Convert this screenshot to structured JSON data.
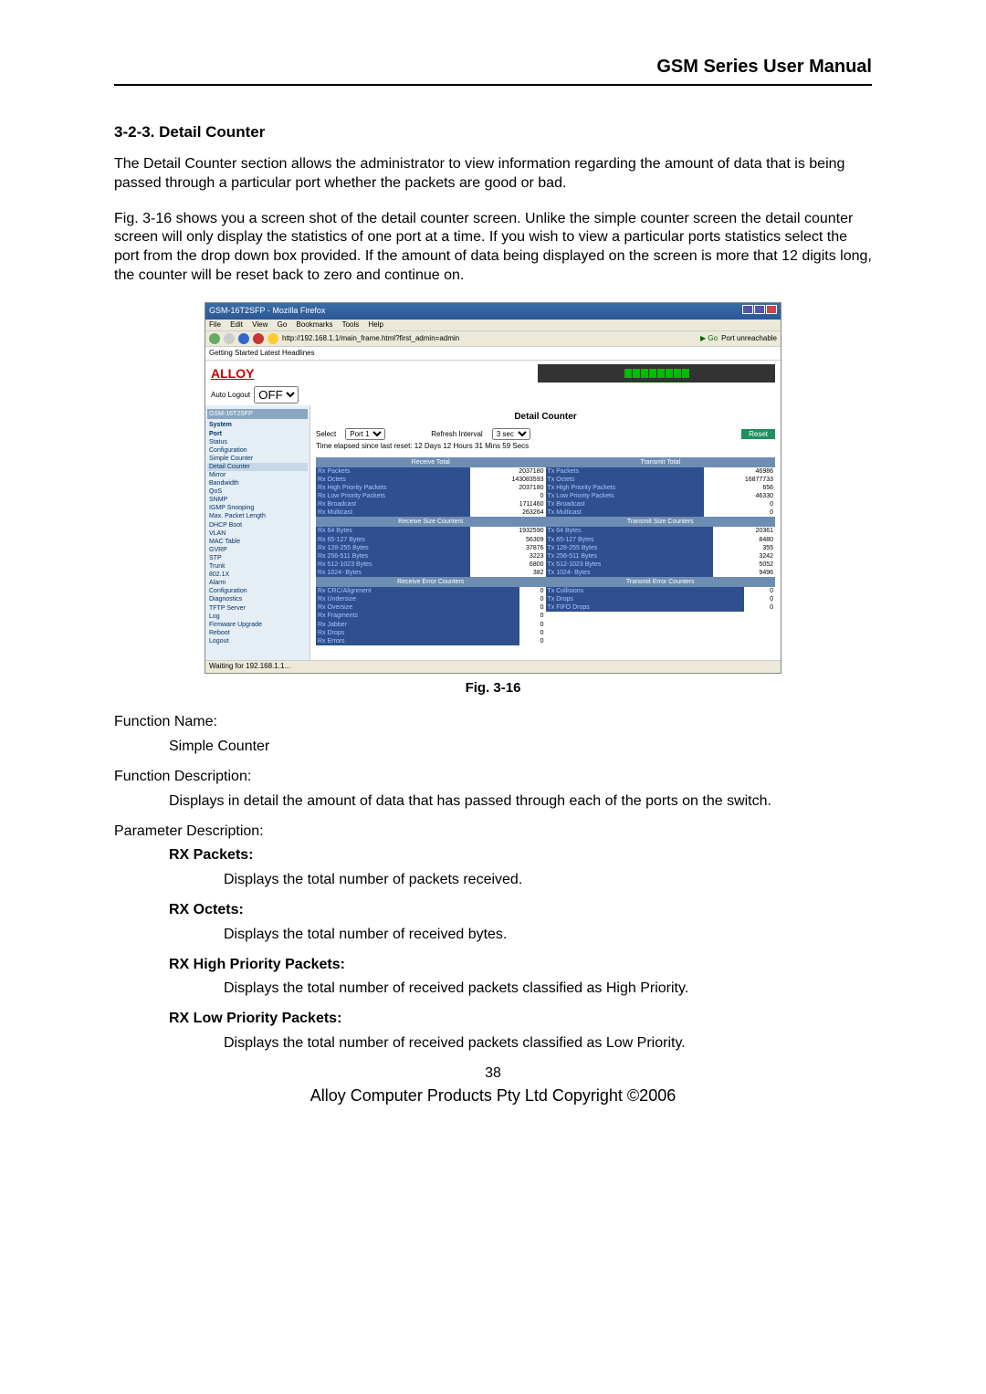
{
  "header_title": "GSM Series User Manual",
  "section_heading": "3-2-3. Detail Counter",
  "para1": "The Detail Counter section allows the administrator to view information regarding the amount of data that is being passed through a particular port whether the packets are good or bad.",
  "para2": "Fig. 3-16 shows you a screen shot of the detail counter screen. Unlike the simple counter screen the detail counter screen will only display the statistics of one port at a time. If you wish to view a particular ports statistics select the port from the drop down box provided. If the amount of data being displayed on the screen is more that 12 digits long, the counter will be reset back to zero and continue on.",
  "figure_caption": "Fig. 3-16",
  "function_name_label": "Function Name:",
  "function_name_value": "Simple Counter",
  "function_desc_label": "Function Description:",
  "function_desc_value": "Displays in detail the amount of data that has passed through each of the ports on the switch.",
  "param_desc_label": "Parameter Description:",
  "params": [
    {
      "label": "RX Packets:",
      "desc": "Displays the total number of packets received."
    },
    {
      "label": "RX Octets:",
      "desc": "Displays the total number of received bytes."
    },
    {
      "label": "RX High Priority Packets:",
      "desc": "Displays the total number of received packets classified as High Priority."
    },
    {
      "label": "RX Low Priority Packets:",
      "desc": "Displays the total number of received packets classified as Low Priority."
    }
  ],
  "page_number": "38",
  "copyright": "Alloy Computer Products Pty Ltd Copyright ©2006",
  "screenshot": {
    "window_title": "GSM-16T2SFP - Mozilla Firefox",
    "menu": [
      "File",
      "Edit",
      "View",
      "Go",
      "Bookmarks",
      "Tools",
      "Help"
    ],
    "url": "http://192.168.1.1/main_frame.html?first_admin=admin",
    "go_label": "Go",
    "tab_label": "Port unreachable",
    "links_bar": "Getting Started   Latest Headlines",
    "brand": "ALLOY",
    "auto_logout_label": "Auto Logout",
    "auto_logout_value": "OFF",
    "sidebar_header": "GSM-16T2SFP",
    "sidebar": {
      "groups": [
        {
          "title": "System"
        },
        {
          "title": "Port",
          "items": [
            "Status",
            "Configuration",
            "Simple Counter",
            "Detail Counter"
          ]
        },
        {
          "items": [
            "Mirror",
            "Bandwidth",
            "QoS",
            "SNMP",
            "IGMP Snooping",
            "Max. Packet Length",
            "DHCP Boot",
            "VLAN",
            "MAC Table",
            "GVRP",
            "STP",
            "Trunk",
            "802.1X",
            "Alarm",
            "Configuration",
            "Diagnostics",
            "TFTP Server",
            "Log",
            "Firmware Upgrade",
            "Reboot",
            "Logout"
          ]
        }
      ],
      "selected": "Detail Counter"
    },
    "detail_counter": {
      "title": "Detail Counter",
      "select_label": "Select",
      "select_value": "Port 1",
      "refresh_label": "Refresh Interval",
      "refresh_value": "3 sec",
      "reset_label": "Reset",
      "elapsed": "Time elapsed since last reset: 12 Days 12 Hours 31 Mins 59 Secs",
      "sections": [
        {
          "left_header": "Receive Total",
          "right_header": "Transmit Total",
          "left": [
            {
              "label": "Rx Packets",
              "value": "2037180"
            },
            {
              "label": "Rx Octets",
              "value": "143083593"
            },
            {
              "label": "Rx High Priority Packets",
              "value": "2037180"
            },
            {
              "label": "Rx Low Priority Packets",
              "value": "0"
            },
            {
              "label": "Rx Broadcast",
              "value": "1711460"
            },
            {
              "label": "Rx Multicast",
              "value": "263264"
            }
          ],
          "right": [
            {
              "label": "Tx Packets",
              "value": "46986"
            },
            {
              "label": "Tx Octets",
              "value": "16877733"
            },
            {
              "label": "Tx High Priority Packets",
              "value": "656"
            },
            {
              "label": "Tx Low Priority Packets",
              "value": "46330"
            },
            {
              "label": "Tx Broadcast",
              "value": "0"
            },
            {
              "label": "Tx Multicast",
              "value": "0"
            }
          ]
        },
        {
          "left_header": "Receive Size Counters",
          "right_header": "Transmit Size Counters",
          "left": [
            {
              "label": "Rx 64 Bytes",
              "value": "1932590"
            },
            {
              "label": "Rx 65-127 Bytes",
              "value": "56309"
            },
            {
              "label": "Rx 128-255 Bytes",
              "value": "37876"
            },
            {
              "label": "Rx 256-511 Bytes",
              "value": "3223"
            },
            {
              "label": "Rx 512-1023 Bytes",
              "value": "6800"
            },
            {
              "label": "Rx 1024- Bytes",
              "value": "382"
            }
          ],
          "right": [
            {
              "label": "Tx 64 Bytes",
              "value": "20361"
            },
            {
              "label": "Tx 65-127 Bytes",
              "value": "8480"
            },
            {
              "label": "Tx 128-255 Bytes",
              "value": "355"
            },
            {
              "label": "Tx 256-511 Bytes",
              "value": "3242"
            },
            {
              "label": "Tx 512-1023 Bytes",
              "value": "5052"
            },
            {
              "label": "Tx 1024- Bytes",
              "value": "9496"
            }
          ]
        },
        {
          "left_header": "Receive Error Counters",
          "right_header": "Transmit Error Counters",
          "left": [
            {
              "label": "Rx CRC/Alignment",
              "value": "0"
            },
            {
              "label": "Rx Undersize",
              "value": "0"
            },
            {
              "label": "Rx Oversize",
              "value": "0"
            },
            {
              "label": "Rx Fragments",
              "value": "0"
            },
            {
              "label": "Rx Jabber",
              "value": "0"
            },
            {
              "label": "Rx Drops",
              "value": "0"
            },
            {
              "label": "Rx Errors",
              "value": "0"
            }
          ],
          "right": [
            {
              "label": "Tx Collisions",
              "value": "0"
            },
            {
              "label": "Tx Drops",
              "value": "0"
            },
            {
              "label": "Tx FIFO Drops",
              "value": "0"
            }
          ]
        }
      ]
    },
    "status_bar": "Waiting for 192.168.1.1..."
  }
}
